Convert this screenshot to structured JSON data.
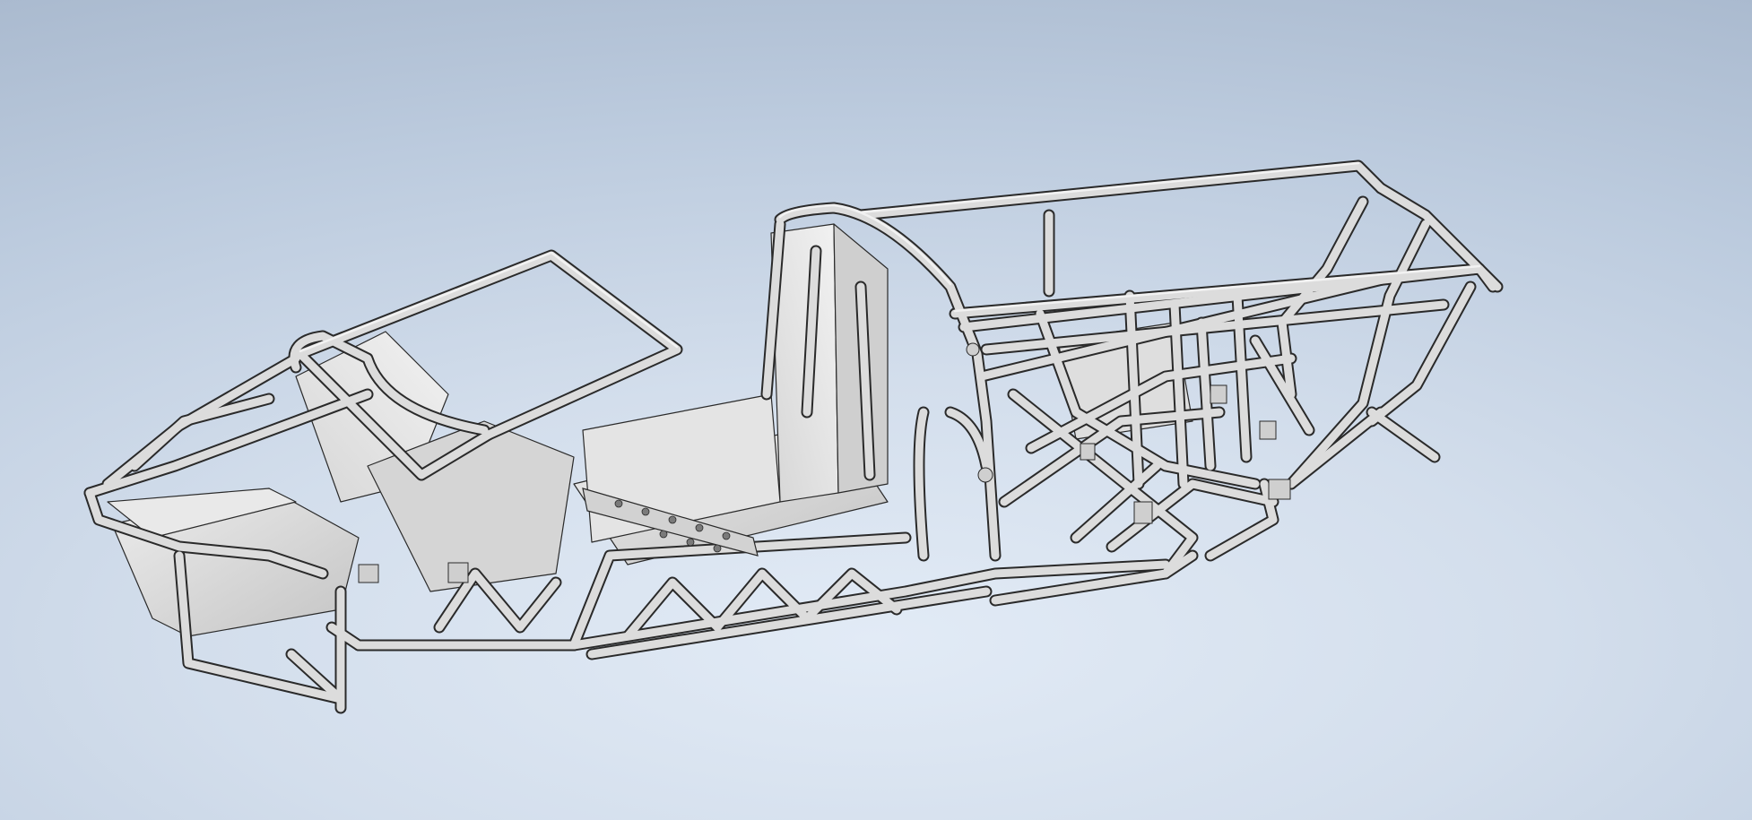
{
  "viewport": {
    "background_top": "#aebdd1",
    "background_center": "#e0e9f4",
    "background_bottom": "#c9d6e6"
  },
  "model": {
    "icon": "chassis-frame-icon",
    "face_color": "#dcdcdc",
    "face_light": "#ececec",
    "face_dark": "#b9b9b9",
    "edge_color": "#2a2a2a"
  }
}
